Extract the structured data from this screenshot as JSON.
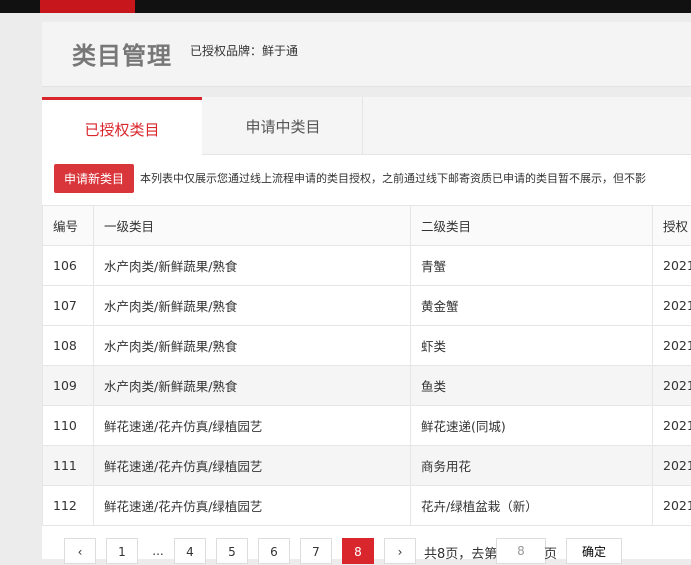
{
  "header": {
    "title": "类目管理",
    "brand_label": "已授权品牌：",
    "brand_value": "鲜于通"
  },
  "tabs": [
    {
      "label": "已授权类目",
      "active": true
    },
    {
      "label": "申请中类目",
      "active": false
    }
  ],
  "apply_button": "申请新类目",
  "notice": "本列表中仅展示您通过线上流程申请的类目授权，之前通过线下邮寄资质已申请的类目暂不展示，但不影",
  "table": {
    "headers": [
      "编号",
      "一级类目",
      "二级类目",
      "授权"
    ],
    "rows": [
      {
        "id": "106",
        "level1": "水产肉类/新鲜蔬果/熟食",
        "level2": "青蟹",
        "date": "2021"
      },
      {
        "id": "107",
        "level1": "水产肉类/新鲜蔬果/熟食",
        "level2": "黄金蟹",
        "date": "2021"
      },
      {
        "id": "108",
        "level1": "水产肉类/新鲜蔬果/熟食",
        "level2": "虾类",
        "date": "2021"
      },
      {
        "id": "109",
        "level1": "水产肉类/新鲜蔬果/熟食",
        "level2": "鱼类",
        "date": "2021"
      },
      {
        "id": "110",
        "level1": "鲜花速递/花卉仿真/绿植园艺",
        "level2": "鲜花速递(同城)",
        "date": "2021"
      },
      {
        "id": "111",
        "level1": "鲜花速递/花卉仿真/绿植园艺",
        "level2": "商务用花",
        "date": "2021"
      },
      {
        "id": "112",
        "level1": "鲜花速递/花卉仿真/绿植园艺",
        "level2": "花卉/绿植盆栽（新）",
        "date": "2021"
      }
    ]
  },
  "pagination": {
    "prev": "‹",
    "next": "›",
    "ellipsis": "...",
    "pages": [
      "1",
      "4",
      "5",
      "6",
      "7",
      "8"
    ],
    "current": "8",
    "total_text": "共8页，去第",
    "input_value": "8",
    "page_suffix": "页",
    "confirm": "确定"
  },
  "colors": {
    "accent": "#d9262c",
    "topbar": "#111111"
  }
}
